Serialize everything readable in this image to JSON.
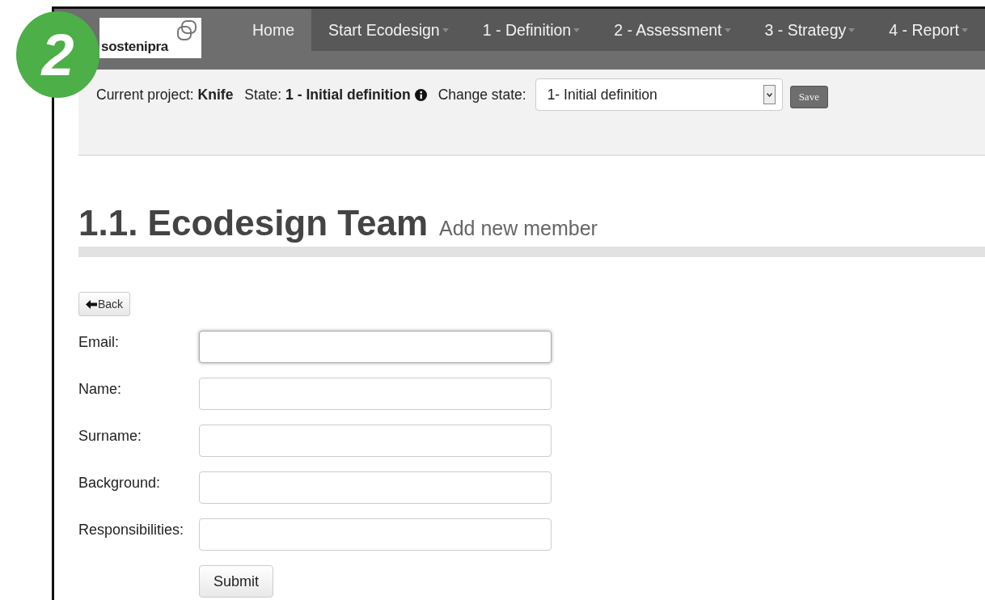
{
  "step_badge": "2",
  "navbar": {
    "logo": "sostenipra",
    "items": [
      {
        "label": "Home",
        "selected": true,
        "has_menu": false
      },
      {
        "label": "Start Ecodesign",
        "selected": false,
        "has_menu": true
      },
      {
        "label": "1 - Definition",
        "selected": false,
        "has_menu": true
      },
      {
        "label": "2 - Assessment",
        "selected": false,
        "has_menu": true
      },
      {
        "label": "3 - Strategy",
        "selected": false,
        "has_menu": true
      },
      {
        "label": "4 - Report",
        "selected": false,
        "has_menu": true
      }
    ]
  },
  "state_bar": {
    "project_label": "Current project:",
    "project": "Knife",
    "state_label": "State:",
    "state": "1 - Initial definition",
    "change_label": "Change state:",
    "select_value": "1- Initial definition",
    "save_button": "Save"
  },
  "heading": {
    "title": "1.1. Ecodesign Team",
    "subtitle": "Add new member"
  },
  "back_button": "Back",
  "form": {
    "fields": [
      {
        "label": "Email:",
        "focused": true
      },
      {
        "label": "Name:",
        "focused": false
      },
      {
        "label": "Surname:",
        "focused": false
      },
      {
        "label": "Background:",
        "focused": false
      },
      {
        "label": "Responsibilities:",
        "focused": false
      }
    ],
    "submit_button": "Submit"
  }
}
